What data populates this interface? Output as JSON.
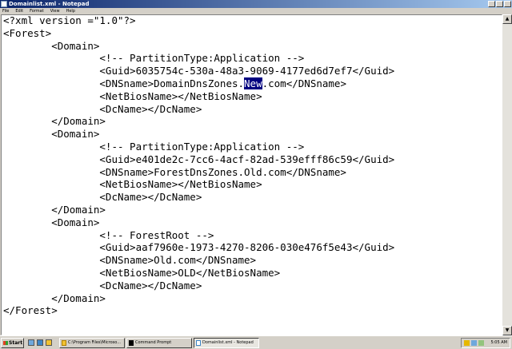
{
  "window": {
    "title": "Domainlist.xml - Notepad"
  },
  "menu": [
    "File",
    "Edit",
    "Format",
    "View",
    "Help"
  ],
  "document": {
    "lines": [
      "<?xml version =\"1.0\"?>",
      "<Forest>",
      "        <Domain>",
      "                <!-- PartitionType:Application -->",
      "                <Guid>6035754c-530a-48a3-9069-4177ed6d7ef7</Guid>",
      "                <DNSname>DomainDnsZones.New.com</DNSname>",
      "                <NetBiosName></NetBiosName>",
      "                <DcName></DcName>",
      "        </Domain>",
      "        <Domain>",
      "                <!-- PartitionType:Application -->",
      "                <Guid>e401de2c-7cc6-4acf-82ad-539efff86c59</Guid>",
      "                <DNSname>ForestDnsZones.Old.com</DNSname>",
      "                <NetBiosName></NetBiosName>",
      "                <DcName></DcName>",
      "        </Domain>",
      "        <Domain>",
      "                <!-- ForestRoot -->",
      "                <Guid>aaf7960e-1973-4270-8206-030e476f5e43</Guid>",
      "                <DNSname>Old.com</DNSname>",
      "                <NetBiosName>OLD</NetBiosName>",
      "                <DcName></DcName>",
      "        </Domain>",
      "</Forest>"
    ],
    "selection": {
      "line": 5,
      "text": "New"
    }
  },
  "taskbar": {
    "start_label": "Start",
    "buttons": [
      {
        "label": "C:\\Program Files\\Microso..."
      },
      {
        "label": "Command Prompt"
      },
      {
        "label": "Domainlist.xml - Notepad",
        "active": true
      }
    ],
    "clock": "5:05 AM"
  },
  "colors": {
    "title_bar": "#0a246a",
    "selection": "#000080",
    "chrome": "#d4d0c8"
  }
}
